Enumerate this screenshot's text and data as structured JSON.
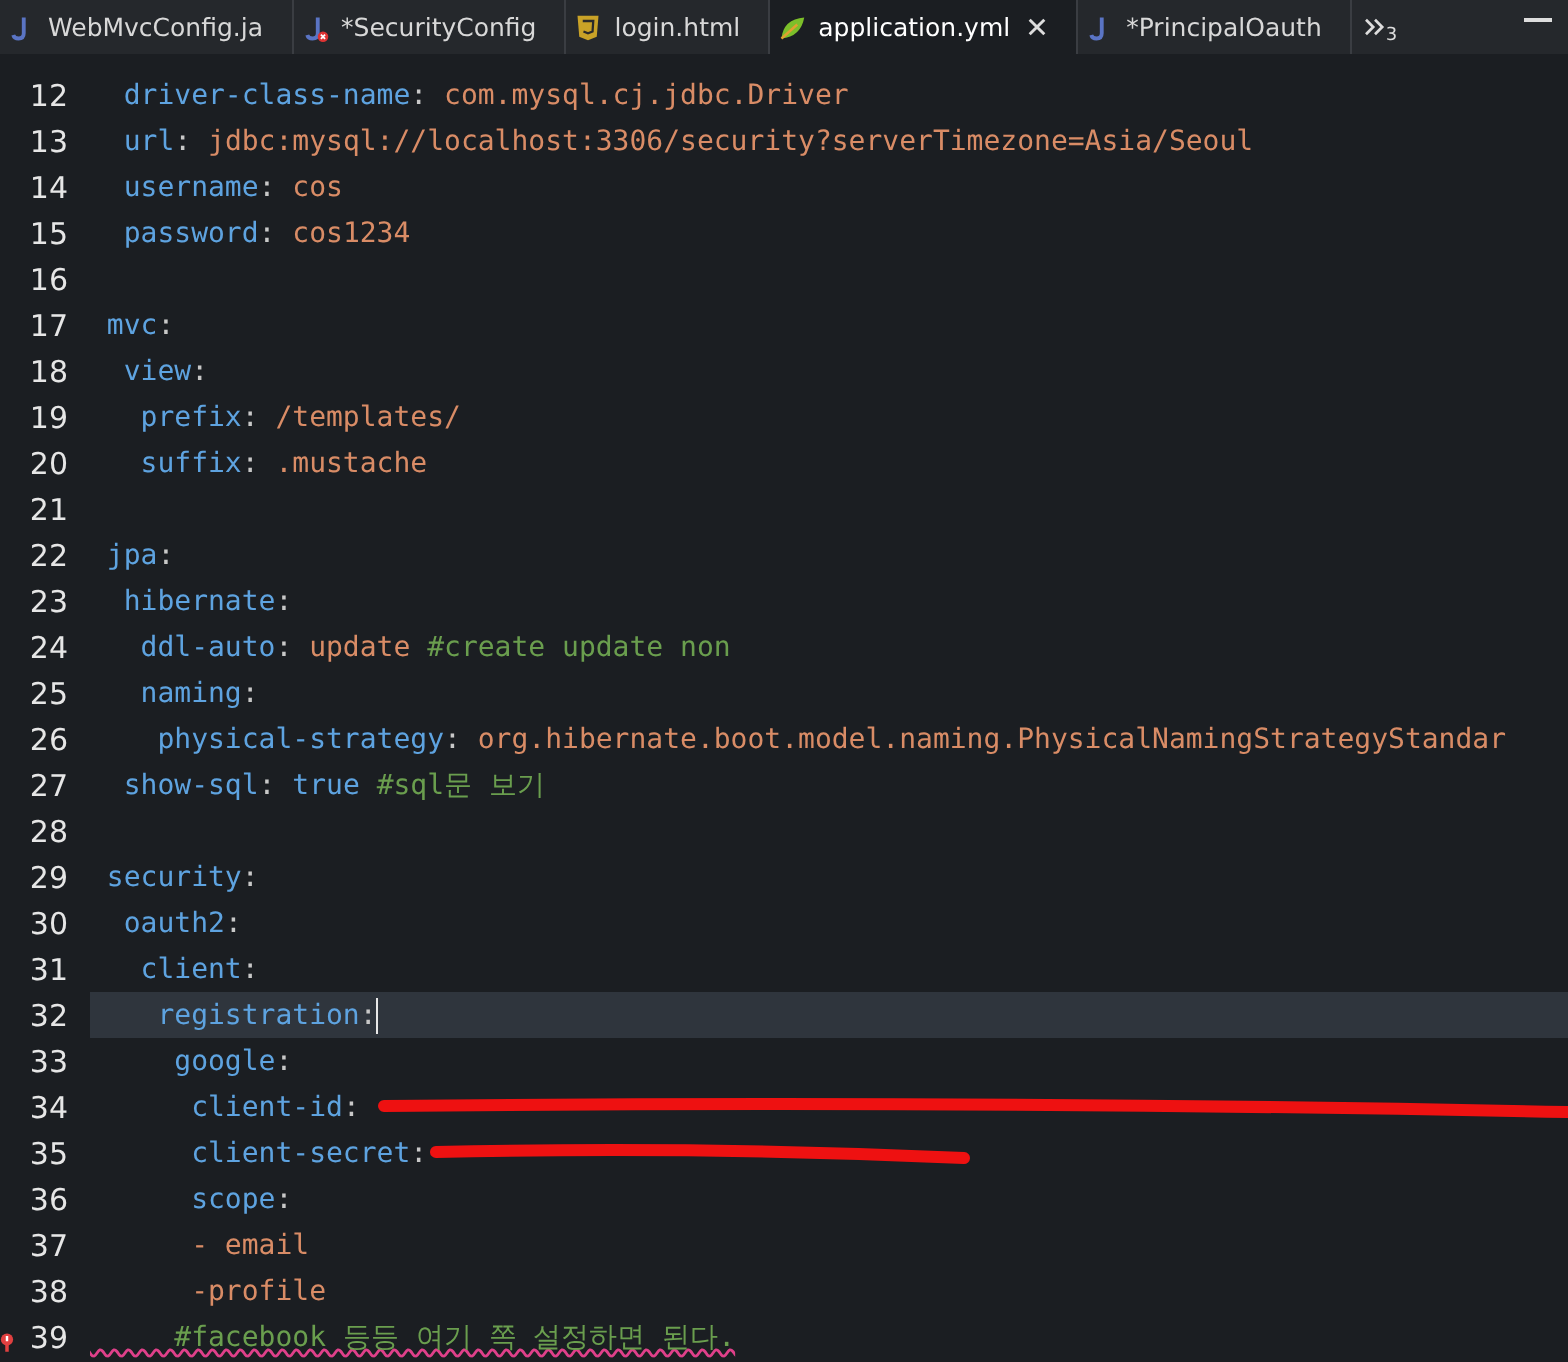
{
  "tabs": [
    {
      "label": "WebMvcConfig.ja",
      "kind": "java",
      "selected": false,
      "closable": false
    },
    {
      "label": "*SecurityConfig",
      "kind": "java-error",
      "selected": false,
      "closable": false
    },
    {
      "label": "login.html",
      "kind": "html",
      "selected": false,
      "closable": false
    },
    {
      "label": "application.yml",
      "kind": "yaml",
      "selected": true,
      "closable": true
    },
    {
      "label": "*PrincipalOauth",
      "kind": "java",
      "selected": false,
      "closable": false
    }
  ],
  "overflow_count": "3",
  "lines": [
    {
      "number": "12",
      "tokens": [
        {
          "kind": "key",
          "text": "  driver-class-name"
        },
        {
          "kind": "punct",
          "text": ": "
        },
        {
          "kind": "value",
          "text": "com.mysql.cj.jdbc.Driver"
        }
      ]
    },
    {
      "number": "13",
      "tokens": [
        {
          "kind": "key",
          "text": "  url"
        },
        {
          "kind": "punct",
          "text": ": "
        },
        {
          "kind": "value",
          "text": "jdbc:mysql://localhost:3306/security?serverTimezone=Asia/Seoul"
        }
      ]
    },
    {
      "number": "14",
      "tokens": [
        {
          "kind": "key",
          "text": "  username"
        },
        {
          "kind": "punct",
          "text": ": "
        },
        {
          "kind": "value",
          "text": "cos"
        }
      ]
    },
    {
      "number": "15",
      "tokens": [
        {
          "kind": "key",
          "text": "  password"
        },
        {
          "kind": "punct",
          "text": ": "
        },
        {
          "kind": "value",
          "text": "cos1234"
        }
      ]
    },
    {
      "number": "16"
    },
    {
      "number": "17",
      "tokens": [
        {
          "kind": "key",
          "text": " mvc"
        },
        {
          "kind": "punct",
          "text": ":"
        }
      ]
    },
    {
      "number": "18",
      "tokens": [
        {
          "kind": "key",
          "text": "  view"
        },
        {
          "kind": "punct",
          "text": ":"
        }
      ]
    },
    {
      "number": "19",
      "tokens": [
        {
          "kind": "key",
          "text": "   prefix"
        },
        {
          "kind": "punct",
          "text": ": "
        },
        {
          "kind": "value",
          "text": "/templates/"
        }
      ]
    },
    {
      "number": "20",
      "tokens": [
        {
          "kind": "key",
          "text": "   suffix"
        },
        {
          "kind": "punct",
          "text": ": "
        },
        {
          "kind": "value",
          "text": ".mustache"
        }
      ]
    },
    {
      "number": "21"
    },
    {
      "number": "22",
      "tokens": [
        {
          "kind": "key",
          "text": " jpa"
        },
        {
          "kind": "punct",
          "text": ":"
        }
      ]
    },
    {
      "number": "23",
      "tokens": [
        {
          "kind": "key",
          "text": "  hibernate"
        },
        {
          "kind": "punct",
          "text": ":"
        }
      ]
    },
    {
      "number": "24",
      "tokens": [
        {
          "kind": "key",
          "text": "   ddl-auto"
        },
        {
          "kind": "punct",
          "text": ": "
        },
        {
          "kind": "value",
          "text": "update "
        },
        {
          "kind": "comment",
          "text": "#create update non"
        }
      ]
    },
    {
      "number": "25",
      "tokens": [
        {
          "kind": "key",
          "text": "   naming"
        },
        {
          "kind": "punct",
          "text": ":"
        }
      ]
    },
    {
      "number": "26",
      "tokens": [
        {
          "kind": "key",
          "text": "    physical-strategy"
        },
        {
          "kind": "punct",
          "text": ": "
        },
        {
          "kind": "value",
          "text": "org.hibernate.boot.model.naming.PhysicalNamingStrategyStandar"
        }
      ]
    },
    {
      "number": "27",
      "tokens": [
        {
          "kind": "key",
          "text": "  show-sql"
        },
        {
          "kind": "punct",
          "text": ": "
        },
        {
          "kind": "keyword",
          "text": "true "
        },
        {
          "kind": "comment",
          "text": "#sql문 보기"
        }
      ]
    },
    {
      "number": "28"
    },
    {
      "number": "29",
      "tokens": [
        {
          "kind": "key",
          "text": " security"
        },
        {
          "kind": "punct",
          "text": ":"
        }
      ]
    },
    {
      "number": "30",
      "tokens": [
        {
          "kind": "key",
          "text": "  oauth2"
        },
        {
          "kind": "punct",
          "text": ":"
        }
      ]
    },
    {
      "number": "31",
      "tokens": [
        {
          "kind": "key",
          "text": "   client"
        },
        {
          "kind": "punct",
          "text": ":"
        }
      ]
    },
    {
      "number": "32",
      "current": true,
      "tokens": [
        {
          "kind": "key",
          "text": "    registration"
        },
        {
          "kind": "punct",
          "text": ":"
        }
      ]
    },
    {
      "number": "33",
      "tokens": [
        {
          "kind": "key",
          "text": "     google"
        },
        {
          "kind": "punct",
          "text": ":"
        }
      ]
    },
    {
      "number": "34",
      "tokens": [
        {
          "kind": "key",
          "text": "      client-id"
        },
        {
          "kind": "punct",
          "text": ": "
        },
        {
          "kind": "scribble-long"
        }
      ]
    },
    {
      "number": "35",
      "tokens": [
        {
          "kind": "key",
          "text": "      client-secret"
        },
        {
          "kind": "punct",
          "text": ":"
        },
        {
          "kind": "scribble-short"
        }
      ]
    },
    {
      "number": "36",
      "tokens": [
        {
          "kind": "key",
          "text": "      scope"
        },
        {
          "kind": "punct",
          "text": ":"
        }
      ]
    },
    {
      "number": "37",
      "tokens": [
        {
          "kind": "value",
          "text": "      - email"
        }
      ]
    },
    {
      "number": "38",
      "tokens": [
        {
          "kind": "value",
          "text": "      -profile"
        }
      ]
    },
    {
      "number": "39",
      "marker": true,
      "tokens": [
        {
          "kind": "comment",
          "text": "     #facebook 등등 여기 쪽 설정하면 된다."
        }
      ]
    }
  ]
}
